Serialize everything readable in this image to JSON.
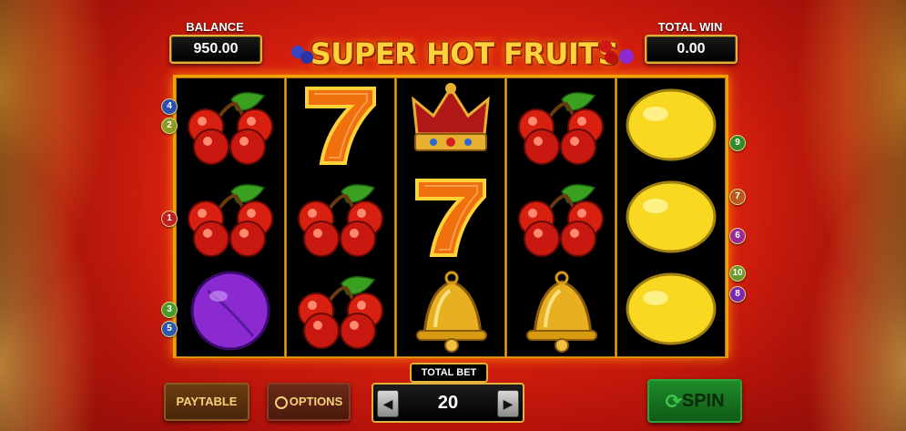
{
  "header": {
    "balance_label": "BALANCE",
    "balance_value": "950.00",
    "total_win_label": "TOTAL WIN",
    "total_win_value": "0.00",
    "logo_text": "SUPER HOT FRUITS"
  },
  "reels": [
    [
      "cherry",
      "cherry",
      "plum"
    ],
    [
      "seven",
      "cherry",
      "cherry"
    ],
    [
      "crown",
      "seven",
      "bell"
    ],
    [
      "cherry",
      "cherry",
      "bell"
    ],
    [
      "lemon",
      "lemon",
      "lemon"
    ]
  ],
  "paylines": {
    "left": [
      {
        "num": "4",
        "color": "#2a4fb0"
      },
      {
        "num": "2",
        "color": "#8a9a20"
      },
      {
        "num": "1",
        "color": "#c02020"
      },
      {
        "num": "3",
        "color": "#4a9a2a"
      },
      {
        "num": "5",
        "color": "#2a5ab0"
      }
    ],
    "right": [
      {
        "num": "9",
        "color": "#2f8a2a"
      },
      {
        "num": "7",
        "color": "#b85a20"
      },
      {
        "num": "6",
        "color": "#9a2a9a"
      },
      {
        "num": "10",
        "color": "#6a9a2a"
      },
      {
        "num": "8",
        "color": "#7a2ab0"
      }
    ]
  },
  "controls": {
    "paytable_label": "PAYTABLE",
    "options_label": "OPTIONS",
    "options_icon": "gear-icon",
    "total_bet_label": "TOTAL BET",
    "total_bet_value": "20",
    "bet_decrease_icon": "left-arrow-icon",
    "bet_increase_icon": "right-arrow-icon",
    "spin_label": "SPIN",
    "spin_icon": "refresh-icon"
  }
}
